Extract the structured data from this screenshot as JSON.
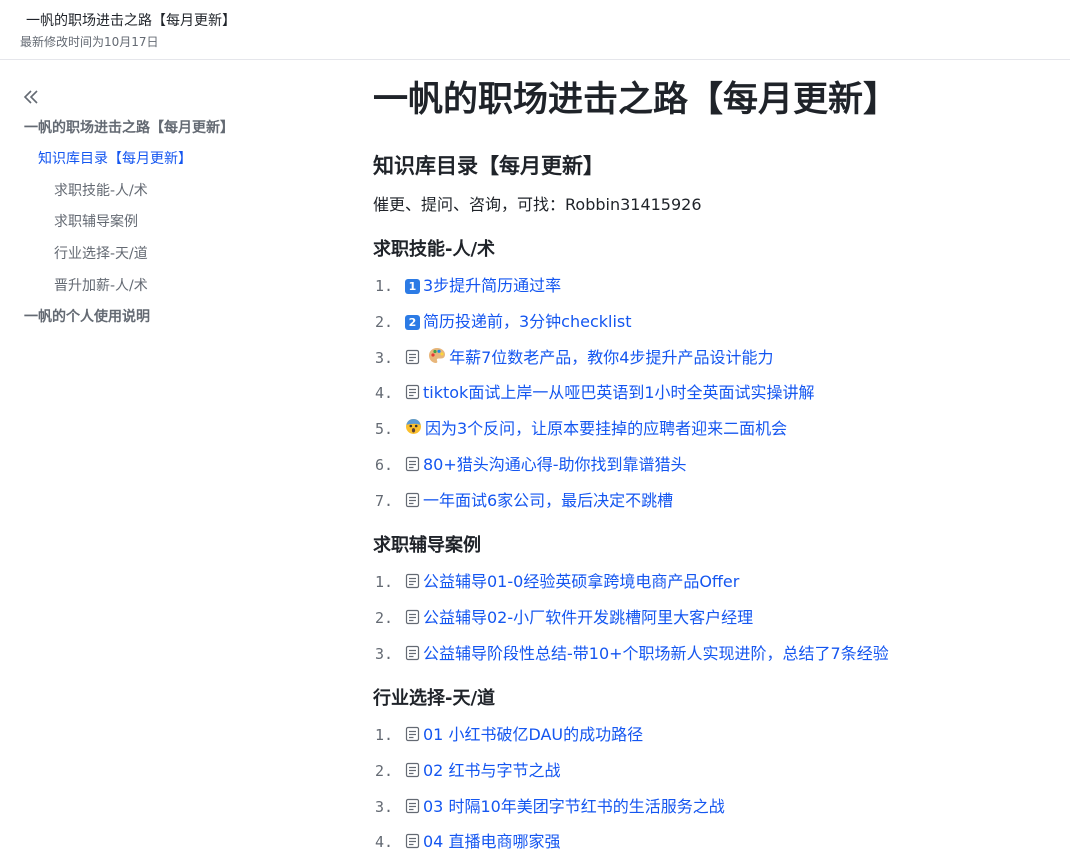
{
  "header": {
    "title": "一帆的职场进击之路【每月更新】",
    "modified": "最新修改时间为10月17日"
  },
  "sidebar": {
    "collapse_icon": "double-chevron-left-icon",
    "items": [
      {
        "label": "一帆的职场进击之路【每月更新】",
        "level": 1
      },
      {
        "label": "知识库目录【每月更新】",
        "level": 2,
        "active": true
      },
      {
        "label": "求职技能-人/术",
        "level": 3
      },
      {
        "label": "求职辅导案例",
        "level": 3
      },
      {
        "label": "行业选择-天/道",
        "level": 3
      },
      {
        "label": "晋升加薪-人/术",
        "level": 3
      },
      {
        "label": "一帆的个人使用说明",
        "level": 1
      }
    ]
  },
  "main": {
    "title": "一帆的职场进击之路【每月更新】",
    "h2": "知识库目录【每月更新】",
    "contact": "催更、提问、咨询，可找：Robbin31415926",
    "sections": [
      {
        "heading": "求职技能-人/术",
        "items": [
          {
            "num": "1.",
            "icon": "keycap-1",
            "text": "3步提升简历通过率"
          },
          {
            "num": "2.",
            "icon": "keycap-2",
            "text": "简历投递前，3分钟checklist"
          },
          {
            "num": "3.",
            "icon": "doc-icon+palette-emoji",
            "text": "年薪7位数老产品，教你4步提升产品设计能力"
          },
          {
            "num": "4.",
            "icon": "doc-icon",
            "text": "tiktok面试上岸一从哑巴英语到1小时全英面试实操讲解"
          },
          {
            "num": "5.",
            "icon": "scream-emoji",
            "text": "因为3个反问，让原本要挂掉的应聘者迎来二面机会"
          },
          {
            "num": "6.",
            "icon": "doc-icon",
            "text": "80+猎头沟通心得-助你找到靠谱猎头"
          },
          {
            "num": "7.",
            "icon": "doc-icon",
            "text": "一年面试6家公司，最后决定不跳槽"
          }
        ]
      },
      {
        "heading": "求职辅导案例",
        "items": [
          {
            "num": "1.",
            "icon": "doc-icon",
            "text": "公益辅导01-0经验英硕拿跨境电商产品Offer"
          },
          {
            "num": "2.",
            "icon": "doc-icon",
            "text": "公益辅导02-小厂软件开发跳槽阿里大客户经理"
          },
          {
            "num": "3.",
            "icon": "doc-icon",
            "text": "公益辅导阶段性总结-带10+个职场新人实现进阶，总结了7条经验"
          }
        ]
      },
      {
        "heading": "行业选择-天/道",
        "items": [
          {
            "num": "1.",
            "icon": "doc-icon",
            "text": "01 小红书破亿DAU的成功路径"
          },
          {
            "num": "2.",
            "icon": "doc-icon",
            "text": "02 红书与字节之战"
          },
          {
            "num": "3.",
            "icon": "doc-icon",
            "text": "03 时隔10年美团字节红书的生活服务之战"
          },
          {
            "num": "4.",
            "icon": "doc-icon",
            "text": "04 直播电商哪家强"
          }
        ]
      }
    ]
  },
  "colors": {
    "link": "#1456f0",
    "text": "#1f2329",
    "muted": "#646a73",
    "keycap": "#2c7be5"
  }
}
